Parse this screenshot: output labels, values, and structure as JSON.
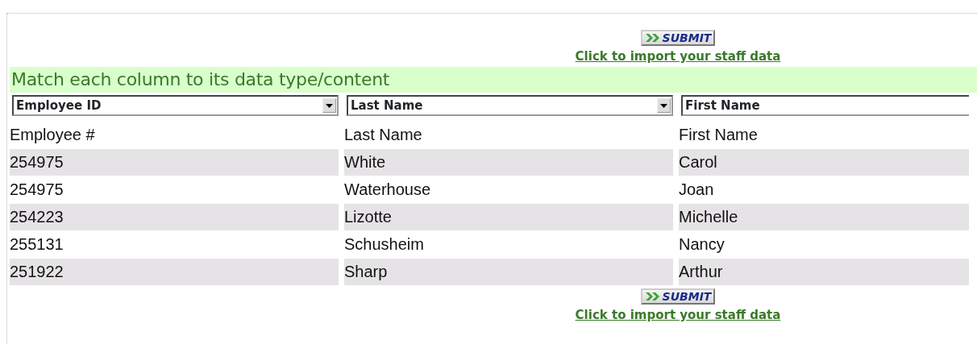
{
  "top_action": {
    "button": "SUBMIT",
    "link": "Click to import your staff data"
  },
  "banner": "Match each column to its data type/content",
  "column_selects": [
    "Employee ID",
    "Last Name",
    "First Name"
  ],
  "table": {
    "columns": [
      "Employee #",
      "Last Name",
      "First Name"
    ],
    "rows": [
      [
        "254975",
        "White",
        "Carol"
      ],
      [
        "254975",
        "Waterhouse",
        "Joan"
      ],
      [
        "254223",
        "Lizotte",
        "Michelle"
      ],
      [
        "255131",
        "Schusheim",
        "Nancy"
      ],
      [
        "251922",
        "Sharp",
        "Arthur"
      ]
    ]
  },
  "bottom_action": {
    "button": "SUBMIT",
    "link": "Click to import your staff data"
  }
}
